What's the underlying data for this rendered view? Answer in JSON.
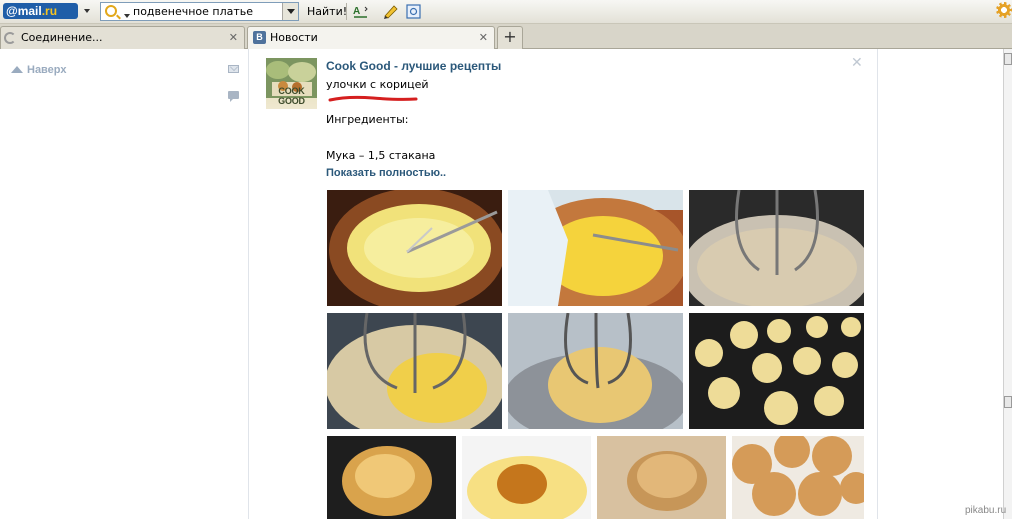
{
  "toolbar": {
    "logo_main": "@mail",
    "logo_suffix": ".ru",
    "search_value": "подвенечное платье",
    "find_label": "Найти!"
  },
  "tabs": [
    {
      "label": "Соединение...",
      "close": "✕"
    },
    {
      "label": "Новости",
      "close": "✕",
      "favicon": "В"
    }
  ],
  "newtab_label": "+",
  "left": {
    "up_label": "Наверх"
  },
  "post": {
    "avatar_text": "COOK GOOD",
    "author": "Cook Good - лучшие рецепты",
    "title": "улочки с корицей",
    "ingredients_label": "Ингредиенты:",
    "flour_line": "Мука – 1,5 стакана",
    "show_more": "Показать полностью..",
    "close": "✕",
    "underline_color": "#d51f1f"
  },
  "photos": [
    "bowl-batter-whisk",
    "pouring-milk-batter",
    "mixer-flour",
    "mixer-flour-eggs",
    "mixer-dough",
    "muffin-tin-dough",
    "baked-bun-in-tin",
    "bun-in-butter",
    "cinnamon-sugar-bun",
    "cinnamon-sugar-donuts"
  ],
  "watermark": "pikabu.ru"
}
